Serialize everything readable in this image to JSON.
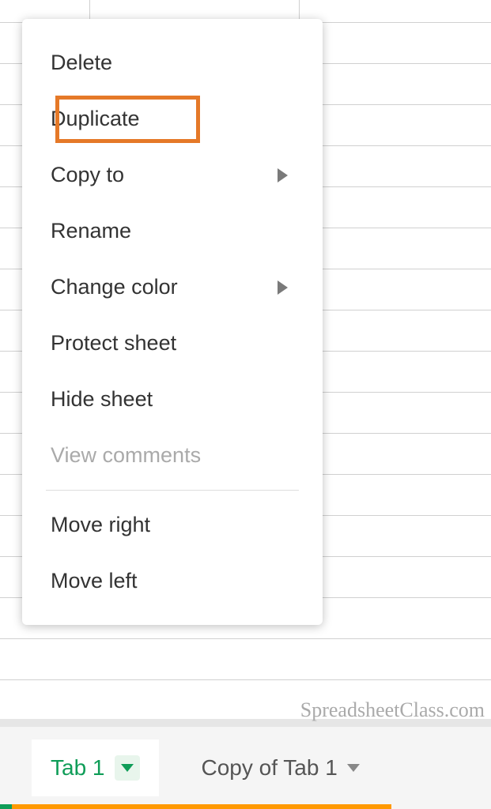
{
  "context_menu": {
    "items": [
      {
        "label": "Delete",
        "has_submenu": false,
        "disabled": false,
        "highlighted": false
      },
      {
        "label": "Duplicate",
        "has_submenu": false,
        "disabled": false,
        "highlighted": true
      },
      {
        "label": "Copy to",
        "has_submenu": true,
        "disabled": false,
        "highlighted": false
      },
      {
        "label": "Rename",
        "has_submenu": false,
        "disabled": false,
        "highlighted": false
      },
      {
        "label": "Change color",
        "has_submenu": true,
        "disabled": false,
        "highlighted": false
      },
      {
        "label": "Protect sheet",
        "has_submenu": false,
        "disabled": false,
        "highlighted": false
      },
      {
        "label": "Hide sheet",
        "has_submenu": false,
        "disabled": false,
        "highlighted": false
      },
      {
        "label": "View comments",
        "has_submenu": false,
        "disabled": true,
        "highlighted": false
      }
    ],
    "items_after_separator": [
      {
        "label": "Move right",
        "has_submenu": false,
        "disabled": false
      },
      {
        "label": "Move left",
        "has_submenu": false,
        "disabled": false
      }
    ]
  },
  "sheet_tabs": {
    "active": {
      "label": "Tab 1"
    },
    "inactive": {
      "label": "Copy of Tab 1"
    }
  },
  "watermark": "SpreadsheetClass.com"
}
